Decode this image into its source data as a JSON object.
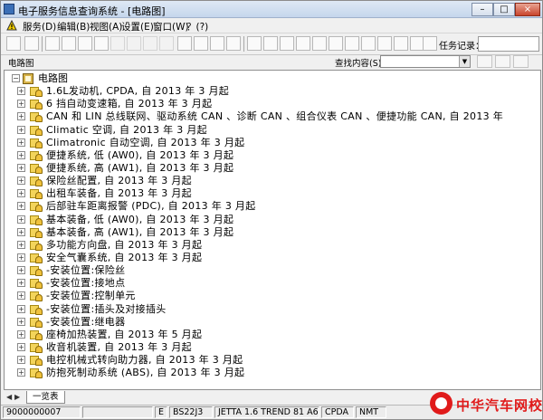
{
  "window": {
    "title": "电子服务信息查询系统 - [电路图]",
    "min_glyph": "–",
    "max_glyph": "□",
    "close_glyph": "×"
  },
  "menu": {
    "items": [
      "服务(D)",
      "编辑(B)",
      "视图(A)",
      "设置(E)",
      "窗口(W)",
      "？(?)"
    ]
  },
  "toolbar": {
    "task_label": "任务记录：",
    "task_value": ""
  },
  "panel": {
    "label": "电路图",
    "search_label": "查找内容(S)：",
    "search_value": ""
  },
  "tree": {
    "root_label": "电路图",
    "items": [
      "1.6L发动机, CPDA, 自 2013 年 3 月起",
      "6 挡自动变速箱, 自 2013 年 3 月起",
      "CAN 和 LIN 总线联网、驱动系统 CAN 、诊断 CAN 、组合仪表 CAN 、便捷功能 CAN, 自 2013 年",
      "Climatic 空调, 自 2013 年 3 月起",
      "Climatronic 自动空调, 自 2013 年 3 月起",
      "便捷系统, 低 (AW0), 自 2013 年 3 月起",
      "便捷系统, 高 (AW1), 自 2013 年 3 月起",
      "保险丝配置, 自 2013 年 3 月起",
      "出租车装备, 自 2013 年 3 月起",
      "后部驻车距离报警 (PDC), 自 2013 年 3 月起",
      "基本装备, 低 (AW0), 自 2013 年 3 月起",
      "基本装备, 高 (AW1), 自 2013 年 3 月起",
      "多功能方向盘, 自 2013 年 3 月起",
      "安全气囊系统, 自 2013 年 3 月起",
      "-安装位置:保险丝",
      "-安装位置:接地点",
      "-安装位置:控制单元",
      "-安装位置:插头及对接插头",
      "-安装位置:继电器",
      "座椅加热装置, 自 2013 年 5 月起",
      "收音机装置, 自 2013 年 3 月起",
      "电控机械式转向助力器, 自 2013 年 3 月起",
      "防抱死制动系统 (ABS), 自 2013 年 3 月起"
    ]
  },
  "tabs": {
    "active": "一览表"
  },
  "status": {
    "cells": [
      "9000000007",
      "",
      "E",
      "BS22J3",
      "JETTA 1.6 TREND 81 A6",
      "CPDA",
      "NMT"
    ]
  },
  "watermark": {
    "text": "中华汽车网校"
  }
}
